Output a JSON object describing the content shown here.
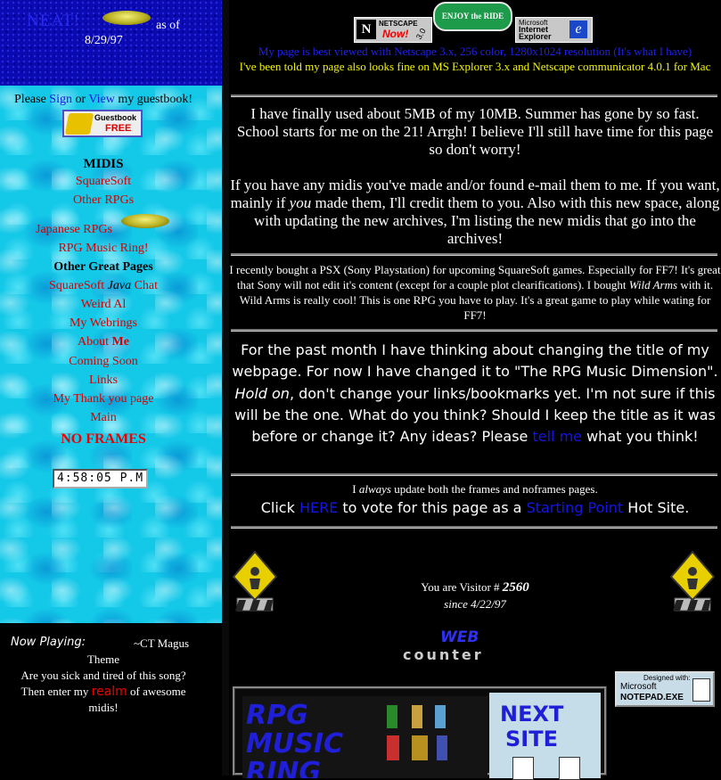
{
  "left": {
    "header": {
      "title": "NEAT!",
      "as_of": "as of",
      "date": "8/29/97"
    },
    "guestbook": {
      "please": "Please",
      "sign": "Sign",
      "or": "or",
      "view": "View",
      "suffix": "my guestbook!",
      "logo_top": "Guestbook",
      "logo_bottom": "FREE"
    },
    "nav": {
      "midis_heading": "MIDIS",
      "squaresoft": "SquareSoft",
      "other_rpgs": "Other RPGs",
      "japanese_rpgs": "Japanese RPGs",
      "rpg_music_ring": "RPG Music Ring!",
      "other_pages_heading": "Other Great Pages",
      "squaresoft_chat_a": "SquareSoft",
      "squaresoft_chat_java": "Java",
      "squaresoft_chat_b": "Chat",
      "weird_al": "Weird Al",
      "webrings": "My Webrings",
      "about_a": "About",
      "about_b": "Me",
      "coming_soon": "Coming Soon",
      "links": "Links",
      "thank_you": "My Thank you page",
      "main": "Main",
      "no_frames": "NO FRAMES"
    },
    "clock": "4:58:05 P.M",
    "now_playing": {
      "label": "Now Playing:",
      "song": "~CT Magus",
      "song2": "Theme",
      "q1": "Are you sick and tired of this song?",
      "q2a": "Then enter my",
      "realm": "realm",
      "q2b": "of awesome",
      "q3": "midis!"
    }
  },
  "right": {
    "badges": {
      "netscape_a": "NETSCAPE",
      "netscape_b": "Now!",
      "netscape_ver": "3.0",
      "ride": "ENJOY the RIDE",
      "ie_a": "Microsoft",
      "ie_b": "Internet",
      "ie_c": "Explorer"
    },
    "best_viewed": "My page is best viewed with Netscape 3.x, 256 color, 1280x1024 resolution (It's what I have)",
    "also_fine": "I've been told my page also looks fine on MS Explorer 3.x and Netscape communicator 4.0.1 for Mac",
    "p1": "I have finally used about 5MB of my 10MB. Summer has gone by so fast. School starts for me on the 21! Arrgh! I believe I'll still have time for this page so don't worry!",
    "p2a": "If you have any midis you've made and/or found e-mail them to me. If you want, mainly if",
    "p2_you": "you",
    "p2b": "made them, I'll credit them to you. Also with this new space, along with updating the new archives, I'm listing the new midis that go into the archives!",
    "p3a": "I recently bought a PSX (Sony Playstation) for upcoming SquareSoft games. Especially for FF7! It's great that Sony will not edit it's content (except for a couple plot clearifications). I bought",
    "p3_wild": "Wild Arms",
    "p3b": "with it. Wild Arms is really cool! This is one RPG you have to play. It's a great game to play while wating for FF7!",
    "p4a": "For the past month I have thinking about changing the title of my webpage. For now I have changed it to \"The RPG Music Dimension\".",
    "p4_hold": "Hold on",
    "p4b": ", don't change your links/bookmarks yet. I'm not sure if this will be the one. What do you think? Should I keep the title as it was before or change it? Any ideas? Please",
    "p4_tell": "tell me",
    "p4c": "what you think!",
    "frames_a": "I",
    "frames_always": "always",
    "frames_b": "update both the frames and noframes pages.",
    "vote_click": "Click",
    "vote_here": "HERE",
    "vote_mid": "to vote for this page as a",
    "vote_sp": "Starting Point",
    "vote_end": "Hot Site.",
    "visitor_label": "You are Visitor #",
    "visitor_count": "2560",
    "since": "since 4/22/97",
    "webcounter_a": "WEB",
    "webcounter_b": "counter",
    "notepad_a": "Designed with:",
    "notepad_b": "Microsoft",
    "notepad_c": "NOTEPAD.EXE",
    "ring_banner": {
      "l1": "RPG",
      "l2": "MUSIC",
      "l3": "RING",
      "next1": "NEXT",
      "next2": "SITE"
    }
  }
}
